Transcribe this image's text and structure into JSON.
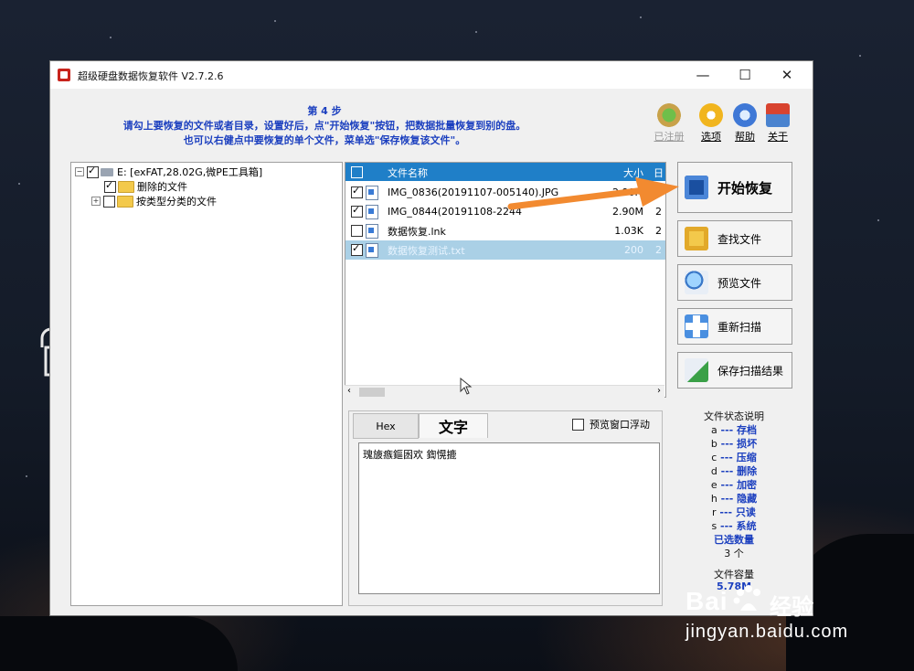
{
  "window": {
    "title": "超级硬盘数据恢复软件 V2.7.2.6",
    "controls": {
      "minimize": "—",
      "maximize": "☐",
      "close": "✕"
    }
  },
  "step": {
    "title": "第 4 步",
    "line1": "请勾上要恢复的文件或者目录，设置好后，点\"开始恢复\"按钮，把数据批量恢复到别的盘。",
    "line2": "也可以右健点中要恢复的单个文件，菜单选\"保存恢复该文件\"。"
  },
  "toolbar": [
    {
      "label": "已注册",
      "icon": "cart-icon",
      "disabled": true
    },
    {
      "label": "选项",
      "icon": "options-gear-icon",
      "disabled": false
    },
    {
      "label": "帮助",
      "icon": "help-icon",
      "disabled": false
    },
    {
      "label": "关于",
      "icon": "about-house-icon",
      "disabled": false
    }
  ],
  "tree": {
    "root": "E: [exFAT,28.02G,微PE工具箱]",
    "items": [
      {
        "label": "删除的文件",
        "checked": true
      },
      {
        "label": "按类型分类的文件",
        "checked": false
      }
    ]
  },
  "filelist": {
    "headers": {
      "name": "文件名称",
      "size": "大小",
      "extra": "日"
    },
    "rows": [
      {
        "name": "IMG_0836(20191107-005140).JPG",
        "size": "2.90M",
        "extra": "2",
        "checked": true,
        "selected": false
      },
      {
        "name": "IMG_0844(20191108-2244",
        "size": "2.90M",
        "extra": "2",
        "checked": true,
        "selected": false
      },
      {
        "name": "数据恢复.lnk",
        "size": "1.03K",
        "extra": "2",
        "checked": false,
        "selected": false
      },
      {
        "name": "数据恢复测试.txt",
        "size": "200",
        "extra": "2",
        "checked": true,
        "selected": true
      }
    ]
  },
  "preview": {
    "tabs": {
      "hex": "Hex",
      "text": "文字"
    },
    "float_label": "预览窗口浮动",
    "float_checked": false,
    "content": "瑰旇瘯鏂囦欢   鍧愰摝"
  },
  "actions": {
    "start": "开始恢复",
    "find": "查找文件",
    "preview": "预览文件",
    "rescan": "重新扫描",
    "save_scan": "保存扫描结果"
  },
  "legend": {
    "title": "文件状态说明",
    "items": [
      {
        "key": "a",
        "text": "存档"
      },
      {
        "key": "b",
        "text": "损坏"
      },
      {
        "key": "c",
        "text": "压缩"
      },
      {
        "key": "d",
        "text": "删除"
      },
      {
        "key": "e",
        "text": "加密"
      },
      {
        "key": "h",
        "text": "隐藏"
      },
      {
        "key": "r",
        "text": "只读"
      },
      {
        "key": "s",
        "text": "系统"
      }
    ],
    "selected_label": "已选数量",
    "selected_count": "3 个",
    "capacity_label": "文件容量",
    "capacity_value": "5.78M"
  },
  "watermark": {
    "brand": "Bai",
    "brand_cn": "经验",
    "url": "jingyan.baidu.com"
  },
  "colors": {
    "accent": "#1b3fbf",
    "header_blue": "#1f7fc8",
    "selection": "#aad0e6",
    "arrow": "#f28a30"
  }
}
